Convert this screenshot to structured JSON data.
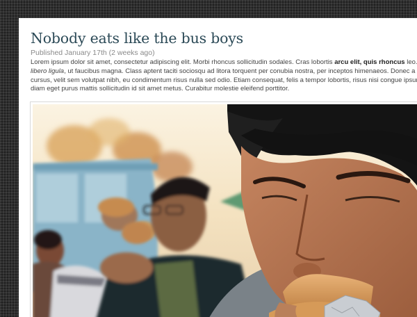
{
  "post": {
    "title": "Nobody eats like the bus boys",
    "meta": "Published January 17th (2 weeks ago)",
    "body": {
      "l1a": "Lorem ipsum dolor sit amet, consectetur adipiscing elit. Morbi rhoncus sollicitudin sodales. Cras lobortis ",
      "l1b": "arcu elit, quis rhoncus",
      "l1c": " leo. Suspendisse",
      "l2a": "libero ligula",
      "l2b": ", ut faucibus magna. Class aptent taciti sociosqu ad litora torquent per conubia nostra, per inceptos himenaeos. Donec a pulvinar",
      "l3": "cursus, velit sem volutpat nibh, eu condimentum risus nulla sed odio. Etiam consequat, felis a tempor lobortis, risus nisi congue ipsum, eget",
      "l4": "diam eget purus mattis sollicitudin id sit amet metus. Curabitur molestie eleifend porttitor."
    }
  },
  "colors": {
    "title": "#2c4a57",
    "meta": "#8a8a8a",
    "body_text": "#444444",
    "page_background": "#2f2f2f"
  }
}
